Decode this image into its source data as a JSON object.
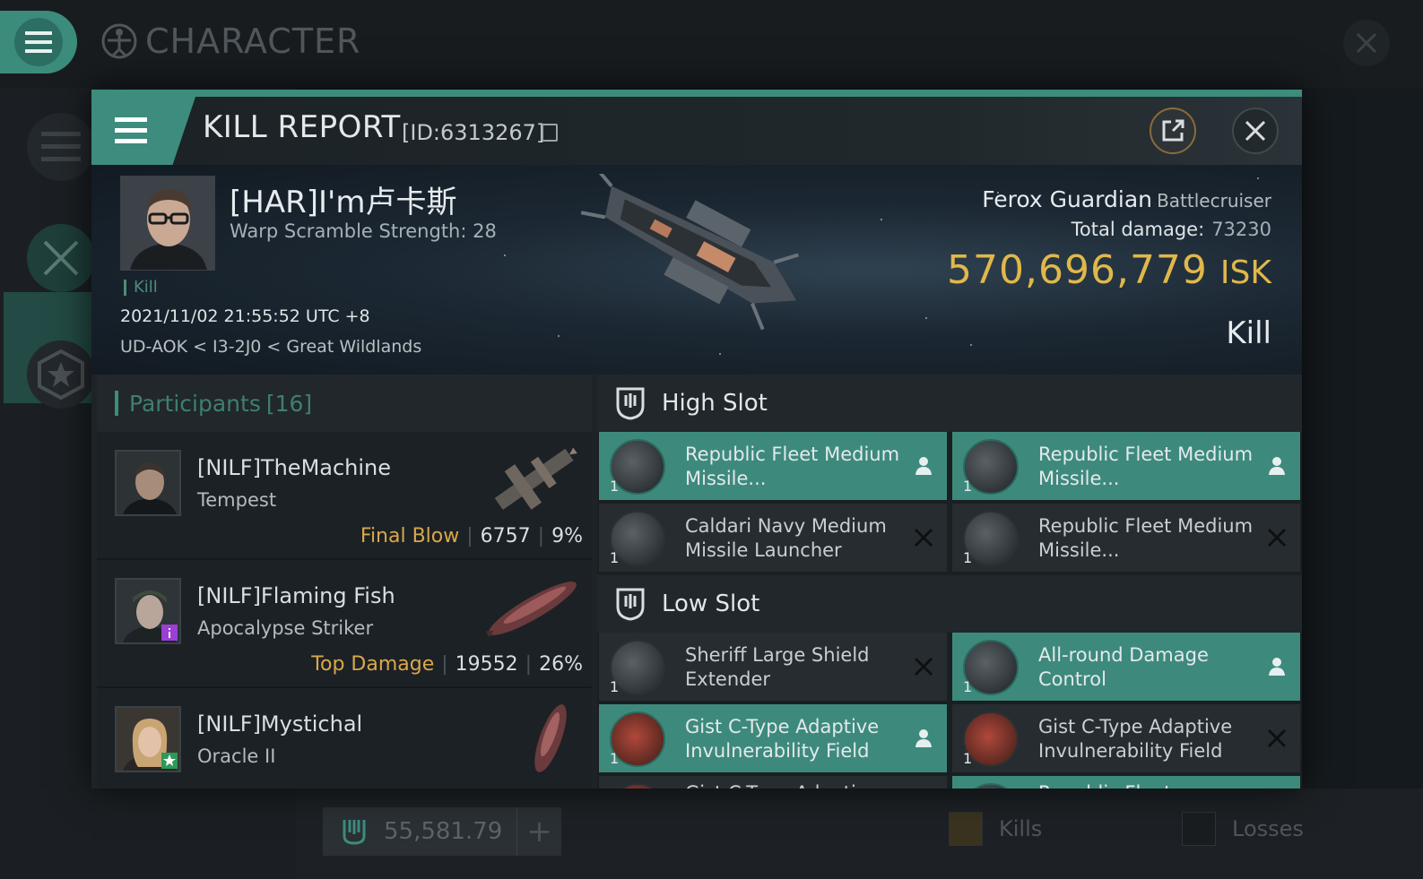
{
  "background": {
    "title": "CHARACTER",
    "isk_balance": "55,581.79",
    "legend": {
      "kills": "Kills",
      "losses": "Losses"
    }
  },
  "kill_report": {
    "title": "KILL REPORT",
    "id_label": "[ID:6313267]",
    "victim": {
      "name": "[HAR]I'm卢卡斯",
      "warp_scramble": "Warp Scramble Strength: 28",
      "tag": "Kill",
      "time": "2021/11/02 21:55:52 UTC +8",
      "location": "UD-AOK < I3-2J0 < Great Wildlands",
      "ship_name": "Ferox Guardian",
      "ship_class": "Battlecruiser",
      "total_damage_label": "Total damage:",
      "total_damage": "73230",
      "isk_value": "570,696,779",
      "isk_unit": "ISK",
      "result": "Kill"
    },
    "participants": {
      "title": "Participants",
      "count": "[16]",
      "rows": [
        {
          "name": "[NILF]TheMachine",
          "ship": "Tempest",
          "role": "Final Blow",
          "damage": "6757",
          "percent": "9%"
        },
        {
          "name": "[NILF]Flaming Fish",
          "ship": "Apocalypse Striker",
          "role": "Top Damage",
          "damage": "19552",
          "percent": "26%"
        },
        {
          "name": "[NILF]Mystichal",
          "ship": "Oracle II",
          "role": "",
          "damage": "",
          "percent": ""
        }
      ]
    },
    "high_slot": {
      "title": "High Slot",
      "modules": [
        {
          "name": "Republic Fleet Medium Missile...",
          "qty": "1",
          "status": "dropped"
        },
        {
          "name": "Republic Fleet Medium Missile...",
          "qty": "1",
          "status": "dropped"
        },
        {
          "name": "Caldari Navy Medium Missile Launcher",
          "qty": "1",
          "status": "destroyed"
        },
        {
          "name": "Republic Fleet Medium Missile...",
          "qty": "1",
          "status": "destroyed"
        }
      ]
    },
    "low_slot": {
      "title": "Low Slot",
      "modules": [
        {
          "name": "Sheriff Large Shield Extender",
          "qty": "1",
          "status": "destroyed"
        },
        {
          "name": "All-round Damage Control",
          "qty": "1",
          "status": "dropped"
        },
        {
          "name": "Gist C-Type Adaptive Invulnerability Field",
          "qty": "1",
          "status": "dropped"
        },
        {
          "name": "Gist C-Type Adaptive Invulnerability Field",
          "qty": "1",
          "status": "destroyed"
        },
        {
          "name": "Gist C-Type Adaptive",
          "qty": "",
          "status": "destroyed"
        },
        {
          "name": "Republic Fleet",
          "qty": "",
          "status": "dropped"
        }
      ]
    }
  },
  "colors": {
    "accent": "#3d8c7d",
    "isk": "#e0b84a",
    "role": "#d9a84a"
  }
}
